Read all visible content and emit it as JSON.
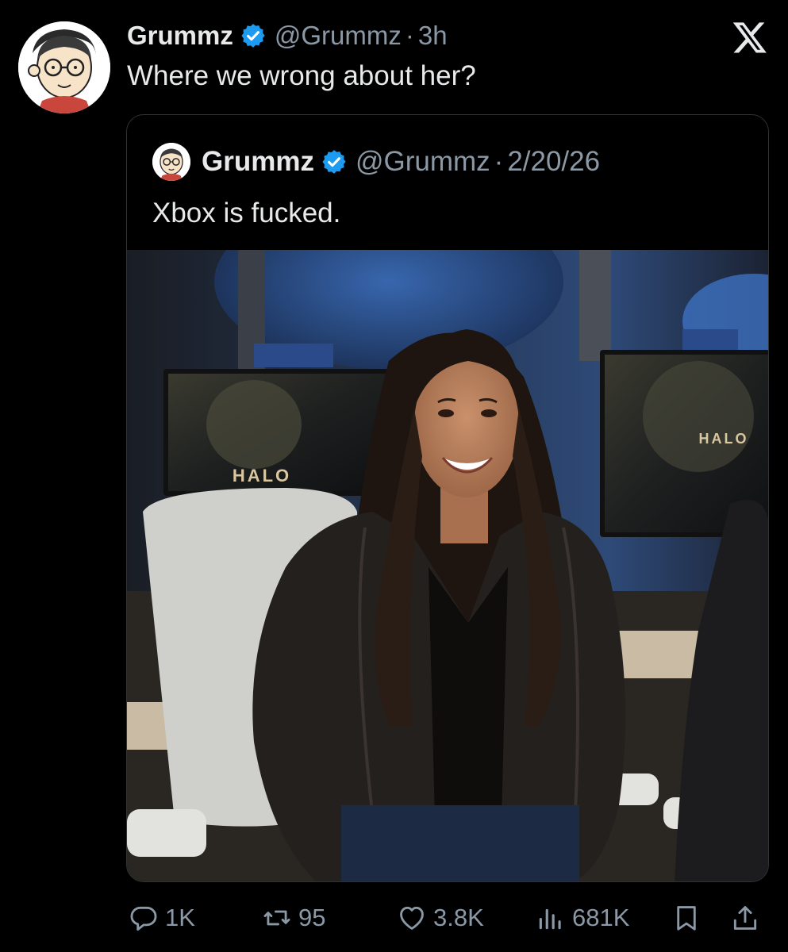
{
  "tweet": {
    "author": {
      "display_name": "Grummz",
      "handle": "@Grummz",
      "avatar_icon": "cartoon-avatar-icon",
      "verified_icon": "verified-badge-icon"
    },
    "separator": "·",
    "time": "3h",
    "text": "Where we wrong about her?"
  },
  "quoted_tweet": {
    "author": {
      "display_name": "Grummz",
      "handle": "@Grummz",
      "avatar_icon": "cartoon-avatar-icon",
      "verified_icon": "verified-badge-icon"
    },
    "separator": "·",
    "date": "2/20/26",
    "text": "Xbox is fucked.",
    "image": {
      "monitor_logo_left": "HALO",
      "monitor_logo_right": "HALO"
    }
  },
  "actions": {
    "replies": "1K",
    "retweets": "95",
    "likes": "3.8K",
    "views": "681K"
  },
  "colors": {
    "background": "#000000",
    "text_primary": "#e7e9ea",
    "text_secondary": "#8b98a5",
    "verified_blue": "#1d9bf0",
    "border": "#2f3336"
  }
}
